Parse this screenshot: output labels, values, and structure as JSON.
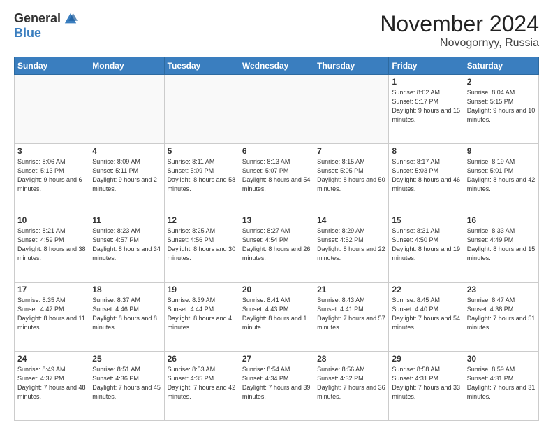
{
  "header": {
    "logo_general": "General",
    "logo_blue": "Blue",
    "month_title": "November 2024",
    "location": "Novogornyy, Russia"
  },
  "weekdays": [
    "Sunday",
    "Monday",
    "Tuesday",
    "Wednesday",
    "Thursday",
    "Friday",
    "Saturday"
  ],
  "weeks": [
    [
      {
        "day": "",
        "info": ""
      },
      {
        "day": "",
        "info": ""
      },
      {
        "day": "",
        "info": ""
      },
      {
        "day": "",
        "info": ""
      },
      {
        "day": "",
        "info": ""
      },
      {
        "day": "1",
        "info": "Sunrise: 8:02 AM\nSunset: 5:17 PM\nDaylight: 9 hours\nand 15 minutes."
      },
      {
        "day": "2",
        "info": "Sunrise: 8:04 AM\nSunset: 5:15 PM\nDaylight: 9 hours\nand 10 minutes."
      }
    ],
    [
      {
        "day": "3",
        "info": "Sunrise: 8:06 AM\nSunset: 5:13 PM\nDaylight: 9 hours\nand 6 minutes."
      },
      {
        "day": "4",
        "info": "Sunrise: 8:09 AM\nSunset: 5:11 PM\nDaylight: 9 hours\nand 2 minutes."
      },
      {
        "day": "5",
        "info": "Sunrise: 8:11 AM\nSunset: 5:09 PM\nDaylight: 8 hours\nand 58 minutes."
      },
      {
        "day": "6",
        "info": "Sunrise: 8:13 AM\nSunset: 5:07 PM\nDaylight: 8 hours\nand 54 minutes."
      },
      {
        "day": "7",
        "info": "Sunrise: 8:15 AM\nSunset: 5:05 PM\nDaylight: 8 hours\nand 50 minutes."
      },
      {
        "day": "8",
        "info": "Sunrise: 8:17 AM\nSunset: 5:03 PM\nDaylight: 8 hours\nand 46 minutes."
      },
      {
        "day": "9",
        "info": "Sunrise: 8:19 AM\nSunset: 5:01 PM\nDaylight: 8 hours\nand 42 minutes."
      }
    ],
    [
      {
        "day": "10",
        "info": "Sunrise: 8:21 AM\nSunset: 4:59 PM\nDaylight: 8 hours\nand 38 minutes."
      },
      {
        "day": "11",
        "info": "Sunrise: 8:23 AM\nSunset: 4:57 PM\nDaylight: 8 hours\nand 34 minutes."
      },
      {
        "day": "12",
        "info": "Sunrise: 8:25 AM\nSunset: 4:56 PM\nDaylight: 8 hours\nand 30 minutes."
      },
      {
        "day": "13",
        "info": "Sunrise: 8:27 AM\nSunset: 4:54 PM\nDaylight: 8 hours\nand 26 minutes."
      },
      {
        "day": "14",
        "info": "Sunrise: 8:29 AM\nSunset: 4:52 PM\nDaylight: 8 hours\nand 22 minutes."
      },
      {
        "day": "15",
        "info": "Sunrise: 8:31 AM\nSunset: 4:50 PM\nDaylight: 8 hours\nand 19 minutes."
      },
      {
        "day": "16",
        "info": "Sunrise: 8:33 AM\nSunset: 4:49 PM\nDaylight: 8 hours\nand 15 minutes."
      }
    ],
    [
      {
        "day": "17",
        "info": "Sunrise: 8:35 AM\nSunset: 4:47 PM\nDaylight: 8 hours\nand 11 minutes."
      },
      {
        "day": "18",
        "info": "Sunrise: 8:37 AM\nSunset: 4:46 PM\nDaylight: 8 hours\nand 8 minutes."
      },
      {
        "day": "19",
        "info": "Sunrise: 8:39 AM\nSunset: 4:44 PM\nDaylight: 8 hours\nand 4 minutes."
      },
      {
        "day": "20",
        "info": "Sunrise: 8:41 AM\nSunset: 4:43 PM\nDaylight: 8 hours\nand 1 minute."
      },
      {
        "day": "21",
        "info": "Sunrise: 8:43 AM\nSunset: 4:41 PM\nDaylight: 7 hours\nand 57 minutes."
      },
      {
        "day": "22",
        "info": "Sunrise: 8:45 AM\nSunset: 4:40 PM\nDaylight: 7 hours\nand 54 minutes."
      },
      {
        "day": "23",
        "info": "Sunrise: 8:47 AM\nSunset: 4:38 PM\nDaylight: 7 hours\nand 51 minutes."
      }
    ],
    [
      {
        "day": "24",
        "info": "Sunrise: 8:49 AM\nSunset: 4:37 PM\nDaylight: 7 hours\nand 48 minutes."
      },
      {
        "day": "25",
        "info": "Sunrise: 8:51 AM\nSunset: 4:36 PM\nDaylight: 7 hours\nand 45 minutes."
      },
      {
        "day": "26",
        "info": "Sunrise: 8:53 AM\nSunset: 4:35 PM\nDaylight: 7 hours\nand 42 minutes."
      },
      {
        "day": "27",
        "info": "Sunrise: 8:54 AM\nSunset: 4:34 PM\nDaylight: 7 hours\nand 39 minutes."
      },
      {
        "day": "28",
        "info": "Sunrise: 8:56 AM\nSunset: 4:32 PM\nDaylight: 7 hours\nand 36 minutes."
      },
      {
        "day": "29",
        "info": "Sunrise: 8:58 AM\nSunset: 4:31 PM\nDaylight: 7 hours\nand 33 minutes."
      },
      {
        "day": "30",
        "info": "Sunrise: 8:59 AM\nSunset: 4:31 PM\nDaylight: 7 hours\nand 31 minutes."
      }
    ]
  ]
}
